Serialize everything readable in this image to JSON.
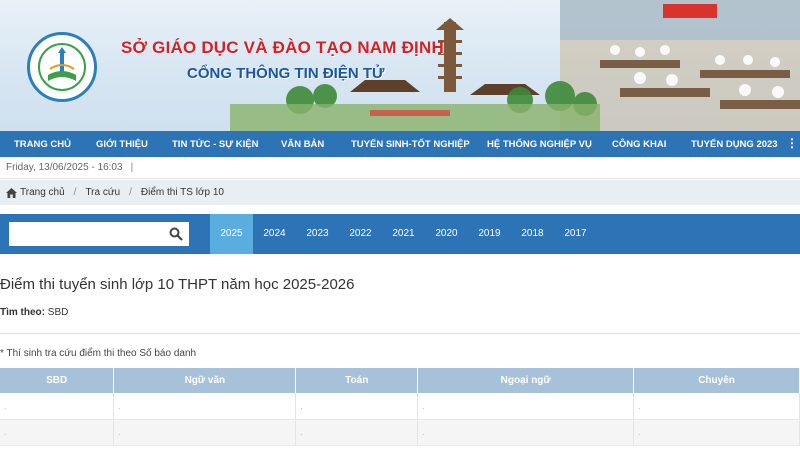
{
  "banner": {
    "title": "SỞ GIÁO DỤC VÀ ĐÀO TẠO NAM ĐỊNH",
    "subtitle": "CỔNG THÔNG TIN ĐIỆN TỬ",
    "logo_icon": "department-logo",
    "title_color": "#d71f26",
    "subtitle_color": "#1b56a3"
  },
  "nav": {
    "items": [
      "TRANG CHỦ",
      "GIỚI THIỆU",
      "TIN TỨC - SỰ KIỆN",
      "VĂN BẢN",
      "TUYỂN SINH-TỐT NGHIỆP",
      "HỆ THỐNG NGHIỆP VỤ",
      "CÔNG KHAI",
      "TUYỂN DỤNG 2023"
    ],
    "more_label": "⋮",
    "color": "#2c74b5"
  },
  "datebar": {
    "text": "Friday, 13/06/2025 - 16:03",
    "separator": "|"
  },
  "breadcrumb": {
    "home": "Trang chủ",
    "level1": "Tra cứu",
    "current": "Điểm thi TS lớp 10",
    "separator": "/"
  },
  "search": {
    "value": "",
    "icon": "search-icon"
  },
  "years": {
    "items": [
      "2025",
      "2024",
      "2023",
      "2022",
      "2021",
      "2020",
      "2019",
      "2018",
      "2017"
    ],
    "active": "2025",
    "active_color": "#5aaedf"
  },
  "content": {
    "title": "Điểm thi tuyển sinh lớp 10 THPT năm học 2025-2026",
    "find_by_label": "Tìm theo:",
    "find_by_value": "SBD",
    "note": "* Thí sinh tra cứu điểm thi theo Số báo danh"
  },
  "table": {
    "headers": [
      "SBD",
      "Ngữ văn",
      "Toán",
      "Ngoại ngữ",
      "Chuyên"
    ],
    "rows": [
      [
        ".",
        ".",
        ".",
        ".",
        "."
      ],
      [
        ".",
        ".",
        ".",
        ".",
        "."
      ]
    ],
    "header_color": "#a7c1da"
  }
}
